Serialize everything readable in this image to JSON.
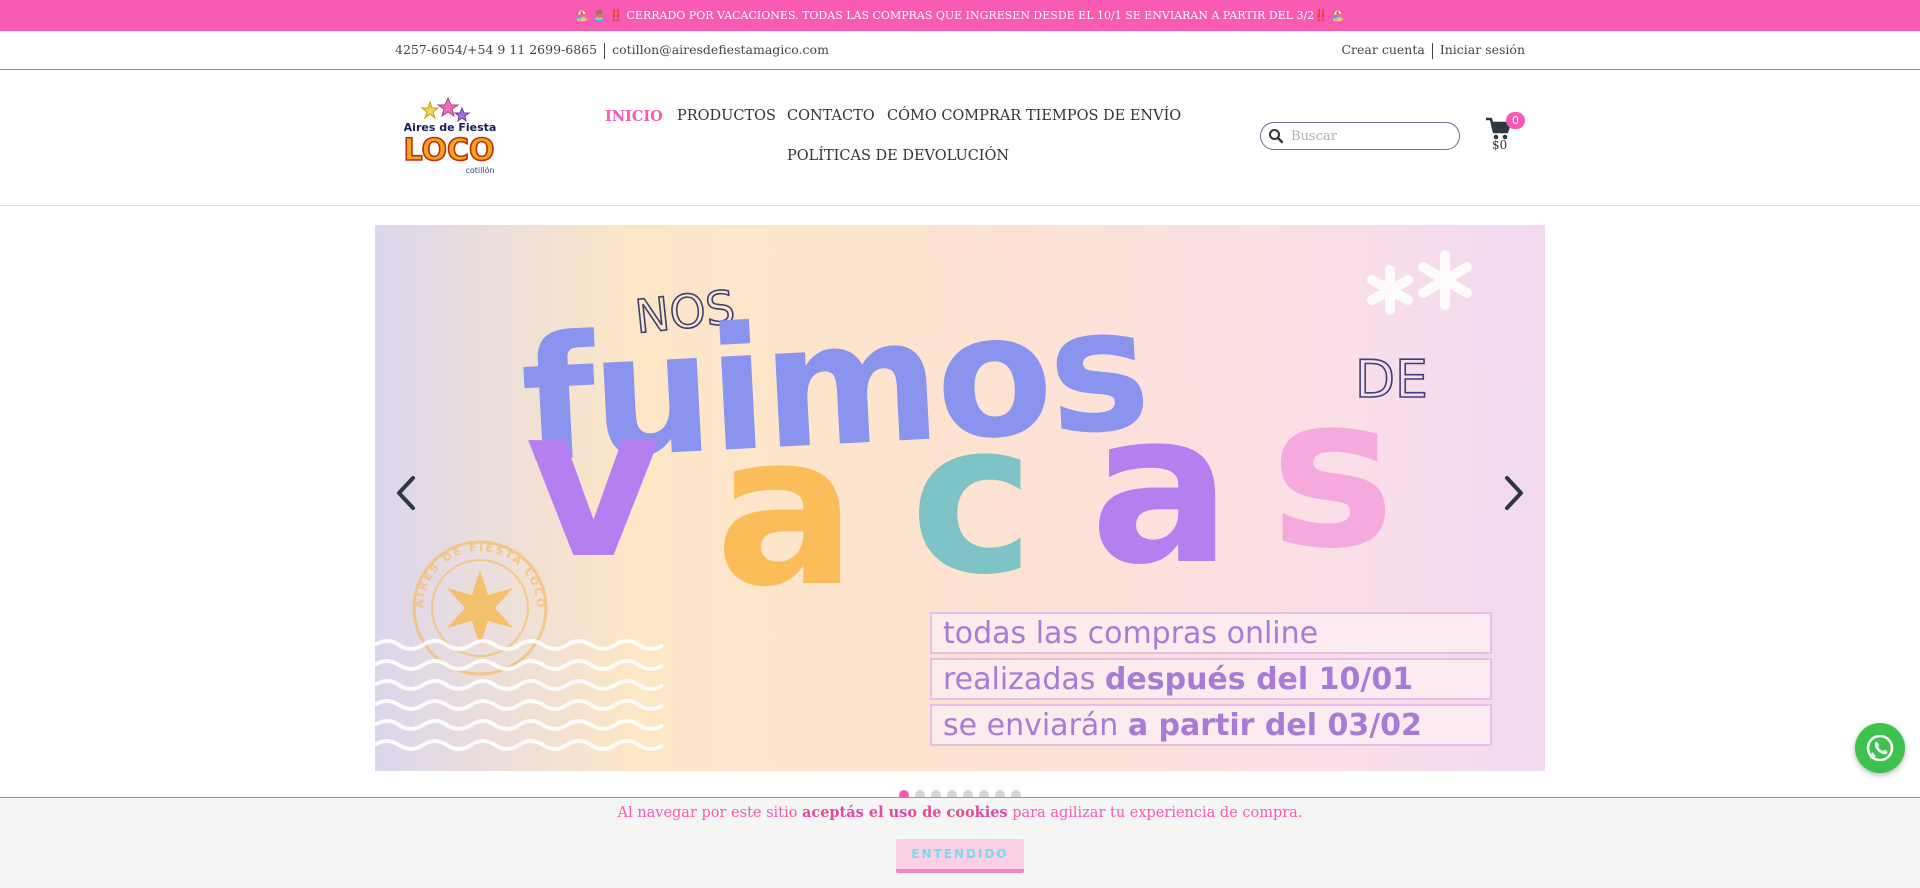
{
  "announcement": "🏖️ 🏝️ ‼️ CERRADO POR VACACIONES. TODAS LAS COMPRAS QUE INGRESEN DESDE EL 10/1 SE ENVIARAN A PARTIR DEL 3/2‼️ 🏖️",
  "contact": {
    "phones": "4257-6054/+54 9 11 2699-6865",
    "email": "cotillon@airesdefiestamagico.com"
  },
  "account": {
    "create": "Crear cuenta",
    "login": "Iniciar sesión"
  },
  "logo": {
    "line1": "Aires de Fiesta",
    "line2": "LOCO",
    "line3": "cotillón"
  },
  "nav": {
    "items": [
      {
        "label": "INICIO"
      },
      {
        "label": "PRODUCTOS"
      },
      {
        "label": "CONTACTO"
      },
      {
        "label": "CÓMO COMPRAR"
      },
      {
        "label": "TIEMPOS DE ENVÍO"
      },
      {
        "label": "POLÍTICAS DE DEVOLUCIÓN"
      }
    ]
  },
  "search": {
    "placeholder": "Buscar"
  },
  "cart": {
    "count": "0",
    "total": "$0"
  },
  "hero": {
    "small1": "NOS",
    "big1": "fuimos",
    "small2": "DE",
    "big2": [
      "v",
      "a",
      "c",
      "a",
      "s"
    ],
    "stamp": "AIRES DE FIESTA LOCO",
    "lines": [
      {
        "plain": "todas las compras online",
        "bold": ""
      },
      {
        "plain": "realizadas ",
        "bold": "después del 10/01"
      },
      {
        "plain": "se enviarán ",
        "bold": "a partir del 03/02"
      }
    ]
  },
  "slider": {
    "total": 8,
    "active": 0
  },
  "cookie": {
    "before": "Al navegar por este sitio ",
    "bold": "aceptás el uso de cookies",
    "after": " para agilizar tu experiencia de compra.",
    "button": "ENTENDIDO"
  },
  "colors": {
    "brand_pink": "#f95ab2",
    "hero_blue": "#8a94ef",
    "hero_purple": "#b57ff0",
    "hero_orange": "#fbbd5a",
    "hero_teal": "#7ec3c6",
    "hero_pink": "#f5a9dd",
    "whatsapp_green": "#3ec24e"
  }
}
